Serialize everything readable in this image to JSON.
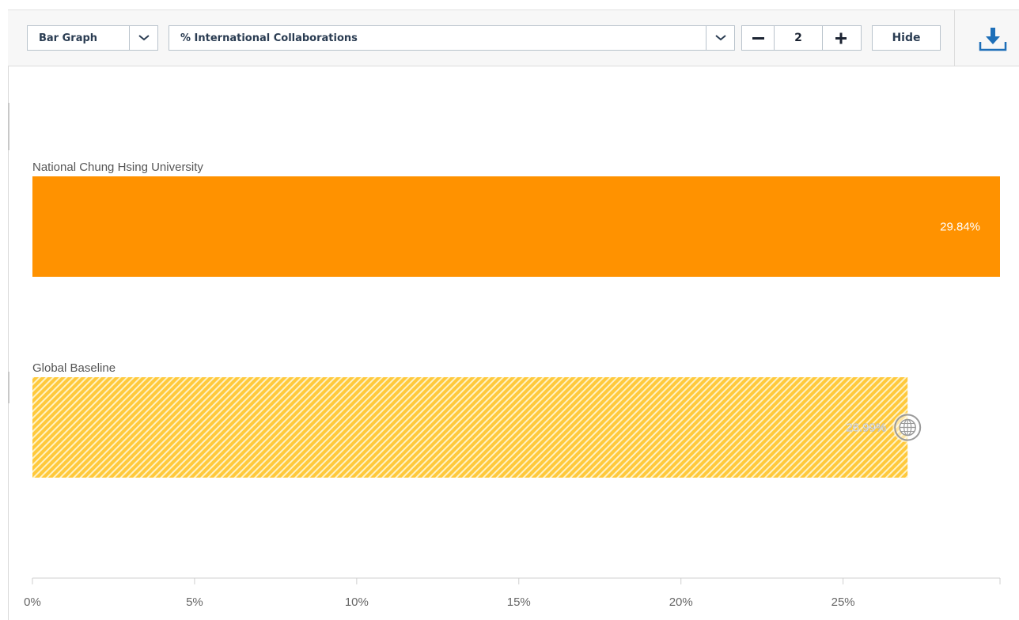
{
  "toolbar": {
    "chart_type_label": "Bar Graph",
    "metric_label": "% International Collaborations",
    "stepper_value": "2",
    "hide_label": "Hide"
  },
  "icons": [
    "chevron-down-icon",
    "minus-icon",
    "plus-icon",
    "download-icon",
    "globe-icon"
  ],
  "colors": {
    "primary_bar": "#ff9200",
    "baseline_bar": "#ffc93c",
    "toolbar_text": "#2a3c52"
  },
  "chart_data": {
    "type": "bar",
    "orientation": "horizontal",
    "categories": [
      "National Chung Hsing University",
      "Global Baseline"
    ],
    "values": [
      29.84,
      26.99
    ],
    "value_labels": [
      "29.84%",
      "26.99%"
    ],
    "xlim": [
      0,
      29.84
    ],
    "x_ticks": [
      0,
      5,
      10,
      15,
      20,
      25
    ],
    "x_tick_labels": [
      "0%",
      "5%",
      "10%",
      "15%",
      "20%",
      "25%"
    ],
    "title": "",
    "xlabel": "",
    "ylabel": "",
    "grid": false
  }
}
